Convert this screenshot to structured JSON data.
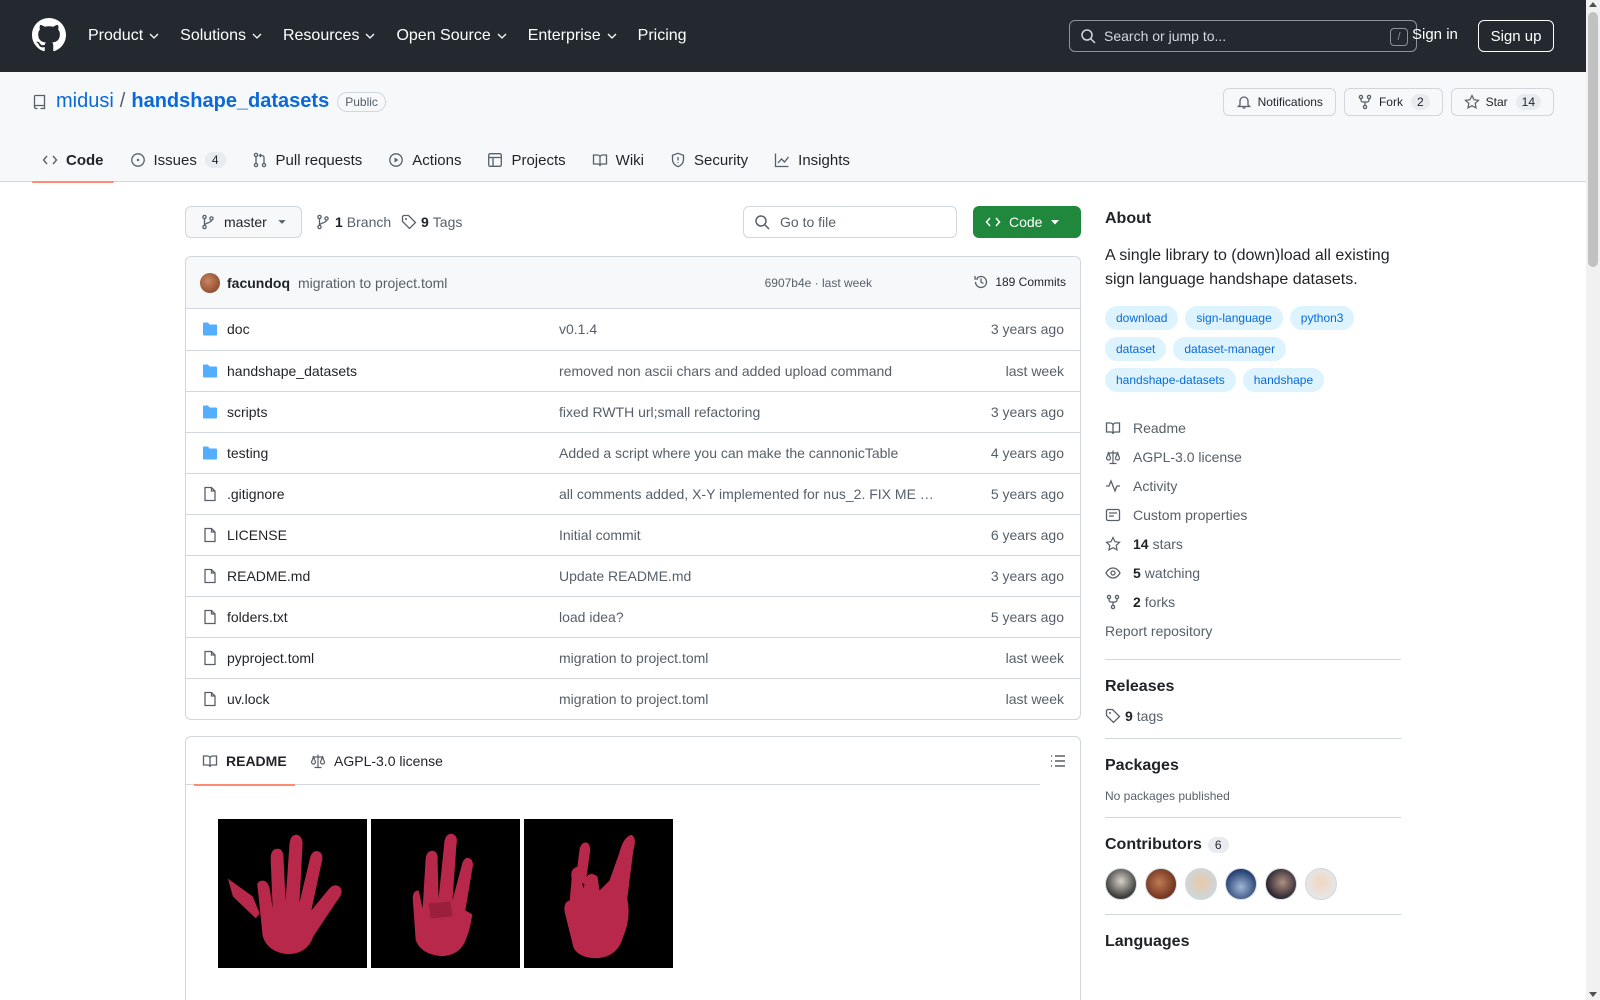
{
  "header": {
    "nav": [
      "Product",
      "Solutions",
      "Resources",
      "Open Source",
      "Enterprise",
      "Pricing"
    ],
    "search_placeholder": "Search or jump to...",
    "search_shortcut": "/",
    "sign_in": "Sign in",
    "sign_up": "Sign up"
  },
  "repo": {
    "owner": "midusi",
    "separator": "/",
    "name": "handshape_datasets",
    "visibility": "Public",
    "notifications_label": "Notifications",
    "fork_label": "Fork",
    "fork_count": "2",
    "star_label": "Star",
    "star_count": "14",
    "tabs": [
      {
        "label": "Code",
        "icon": "code-icon"
      },
      {
        "label": "Issues",
        "icon": "issue-icon",
        "count": "4"
      },
      {
        "label": "Pull requests",
        "icon": "pull-request-icon"
      },
      {
        "label": "Actions",
        "icon": "play-icon"
      },
      {
        "label": "Projects",
        "icon": "table-icon"
      },
      {
        "label": "Wiki",
        "icon": "book-icon"
      },
      {
        "label": "Security",
        "icon": "shield-icon"
      },
      {
        "label": "Insights",
        "icon": "graph-icon"
      }
    ]
  },
  "toolbar": {
    "branch": "master",
    "branch_count": "1",
    "branch_label": "Branch",
    "tag_count": "9",
    "tag_label": "Tags",
    "goto_placeholder": "Go to file",
    "code_button": "Code"
  },
  "commit": {
    "author": "facundoq",
    "message": "migration to project.toml",
    "sha_time": "6907b4e · last week",
    "count_label": "189 Commits"
  },
  "files": [
    {
      "name": "doc",
      "type": "folder",
      "message": "v0.1.4",
      "date": "3 years ago"
    },
    {
      "name": "handshape_datasets",
      "type": "folder",
      "message": "removed non ascii chars and added upload command",
      "date": "last week"
    },
    {
      "name": "scripts",
      "type": "folder",
      "message": "fixed RWTH url;small refactoring",
      "date": "3 years ago"
    },
    {
      "name": "testing",
      "type": "folder",
      "message": "Added a script where you can make the cannonicTable",
      "date": "4 years ago"
    },
    {
      "name": ".gitignore",
      "type": "file",
      "message": "all comments added, X-Y implemented for nus_2. FIX ME n…",
      "date": "5 years ago"
    },
    {
      "name": "LICENSE",
      "type": "file",
      "message": "Initial commit",
      "date": "6 years ago"
    },
    {
      "name": "README.md",
      "type": "file",
      "message": "Update README.md",
      "date": "3 years ago"
    },
    {
      "name": "folders.txt",
      "type": "file",
      "message": "load idea?",
      "date": "5 years ago"
    },
    {
      "name": "pyproject.toml",
      "type": "file",
      "message": "migration to project.toml",
      "date": "last week"
    },
    {
      "name": "uv.lock",
      "type": "file",
      "message": "migration to project.toml",
      "date": "last week"
    }
  ],
  "readme": {
    "tab_readme": "README",
    "tab_license": "AGPL-3.0 license"
  },
  "about": {
    "title": "About",
    "description": "A single library to (down)load all existing sign language handshape datasets.",
    "topics": [
      "download",
      "sign-language",
      "python3",
      "dataset",
      "dataset-manager",
      "handshape-datasets",
      "handshape"
    ],
    "readme_link": "Readme",
    "license_link": "AGPL-3.0 license",
    "activity_link": "Activity",
    "custom_properties_link": "Custom properties",
    "stars_count": "14",
    "stars_label": "stars",
    "watching_count": "5",
    "watching_label": "watching",
    "forks_count": "2",
    "forks_label": "forks",
    "report_link": "Report repository"
  },
  "releases": {
    "title": "Releases",
    "tags_count": "9",
    "tags_label": "tags"
  },
  "packages": {
    "title": "Packages",
    "empty": "No packages published"
  },
  "contributors": {
    "title": "Contributors",
    "count": "6"
  },
  "languages": {
    "title": "Languages"
  },
  "colors": {
    "header_bg": "#24292f",
    "link": "#0969da",
    "code_button": "#1f883d",
    "tab_underline": "#fd8c73",
    "topic_bg": "#ddf4ff",
    "folder_icon": "#54aeff",
    "hand": "#b8284a"
  }
}
